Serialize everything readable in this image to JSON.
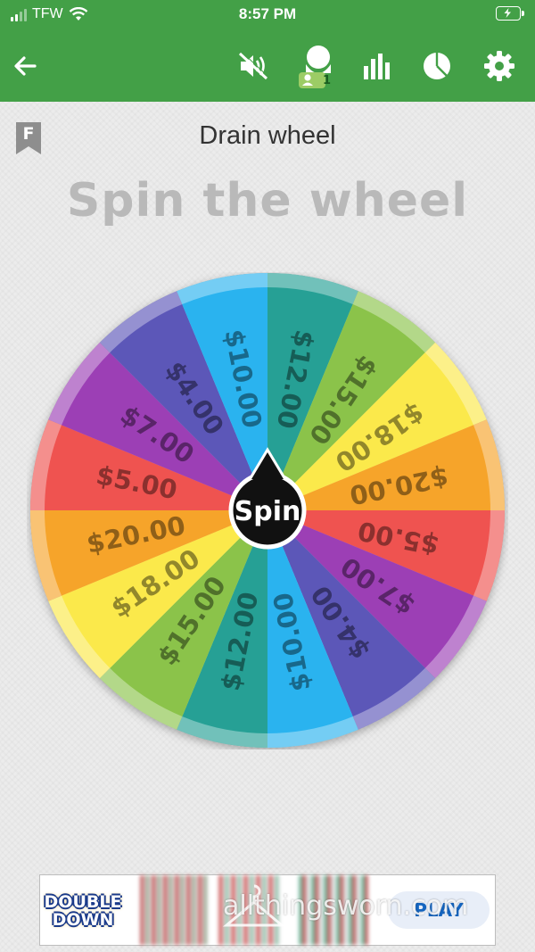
{
  "status_bar": {
    "carrier": "TFW",
    "time": "8:57 PM"
  },
  "toolbar": {
    "back_icon": "arrow-left-icon",
    "mute_icon": "volume-muted-icon",
    "players_icon": "players-icon",
    "players_count": "1",
    "stats_icon": "bar-chart-icon",
    "pie_icon": "pie-chart-icon",
    "settings_icon": "gear-icon",
    "background_color": "#43a047"
  },
  "header": {
    "bookmark_letter": "F",
    "wheel_name": "Drain wheel",
    "title": "Spin the wheel"
  },
  "wheel": {
    "spin_label": "Spin",
    "segments": [
      {
        "label": "$12.00",
        "color": "#26a095"
      },
      {
        "label": "$15.00",
        "color": "#8bc34a"
      },
      {
        "label": "$18.00",
        "color": "#fbe94b"
      },
      {
        "label": "$20.00",
        "color": "#f6a42a"
      },
      {
        "label": "$5.00",
        "color": "#ef5350"
      },
      {
        "label": "$7.00",
        "color": "#9c3fb5"
      },
      {
        "label": "$4.00",
        "color": "#5c57b8"
      },
      {
        "label": "$10.00",
        "color": "#2ab3ef"
      },
      {
        "label": "$12.00",
        "color": "#26a095"
      },
      {
        "label": "$15.00",
        "color": "#8bc34a"
      },
      {
        "label": "$18.00",
        "color": "#fbe94b"
      },
      {
        "label": "$20.00",
        "color": "#f6a42a"
      },
      {
        "label": "$5.00",
        "color": "#ef5350"
      },
      {
        "label": "$7.00",
        "color": "#9c3fb5"
      },
      {
        "label": "$4.00",
        "color": "#5c57b8"
      },
      {
        "label": "$10.00",
        "color": "#2ab3ef"
      }
    ]
  },
  "ad": {
    "logo_line1": "DOUBLE",
    "logo_line2": "DOWN",
    "play_label": "PLAY",
    "watermark": "allthingsworn.com"
  }
}
